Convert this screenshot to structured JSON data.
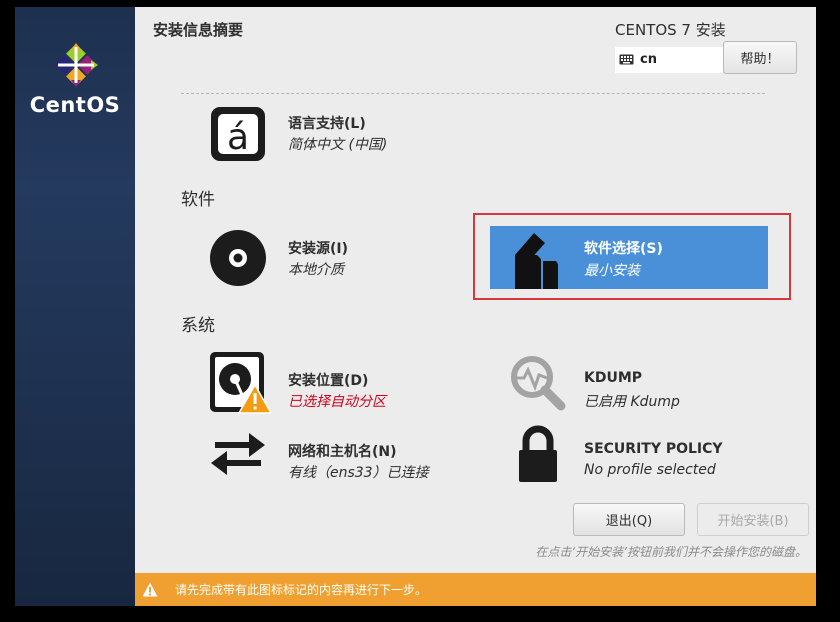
{
  "sidebar": {
    "brand": "CentOS"
  },
  "header": {
    "summary_title": "安装信息摘要",
    "product_title": "CENTOS 7 安装",
    "keyboard_layout": "cn",
    "help_label": "帮助！"
  },
  "localization": {
    "language_support": {
      "title": "语言支持(L)",
      "status": "简体中文 (中国)",
      "icon": "language-icon"
    }
  },
  "software": {
    "heading": "软件",
    "install_source": {
      "title": "安装源(I)",
      "status": "本地介质",
      "icon": "disc-icon"
    },
    "software_selection": {
      "title": "软件选择(S)",
      "status": "最小安装",
      "icon": "package-icon",
      "selected": true
    }
  },
  "system": {
    "heading": "系统",
    "install_destination": {
      "title": "安装位置(D)",
      "status": "已选择自动分区",
      "status_color": "#d0021b",
      "icon": "hard-disk-icon",
      "warning": true
    },
    "kdump": {
      "title": "KDUMP",
      "status": "已启用 Kdump",
      "icon": "kdump-search-icon"
    },
    "network": {
      "title": "网络和主机名(N)",
      "status": "有线（ens33）已连接",
      "icon": "network-arrows-icon"
    },
    "security_policy": {
      "title": "SECURITY POLICY",
      "status": "No profile selected",
      "icon": "lock-icon"
    }
  },
  "footer": {
    "quit_label": "退出(Q)",
    "begin_install_label": "开始安装(B)",
    "disk_note": "在点击‘开始安装’按钮前我们并不会操作您的磁盘。"
  },
  "warning_bar": {
    "message": "请先完成带有此图标标记的内容再进行下一步。",
    "color": "#f0a030"
  },
  "colors": {
    "accent": "#4a90d9",
    "highlight_outline": "#d3383a",
    "sidebar": "#243a5e"
  }
}
